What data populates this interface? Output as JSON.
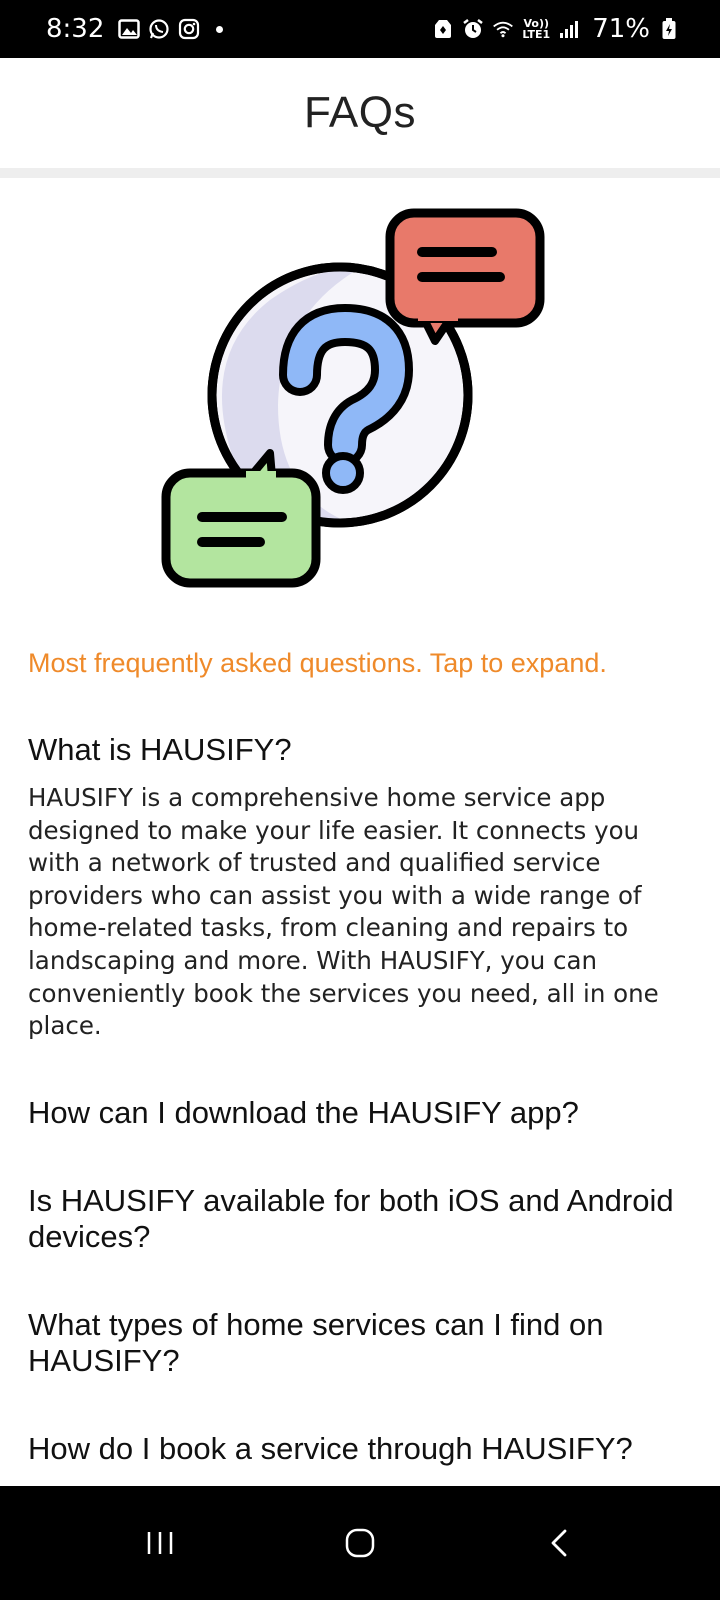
{
  "status_bar": {
    "time": "8:32",
    "network_line1": "Vo))",
    "network_line2": "LTE1",
    "battery": "71%"
  },
  "header": {
    "title": "FAQs"
  },
  "intro": {
    "text": "Most frequently asked questions. Tap to expand."
  },
  "faqs": [
    {
      "question": "What is HAUSIFY?",
      "answer": "HAUSIFY is a comprehensive home service app designed to make your life easier. It connects you with a network of trusted and qualified service providers who can assist you with a wide range of home-related tasks, from cleaning and repairs to landscaping and more. With HAUSIFY, you can conveniently book the services you need, all in one place.",
      "expanded": true
    },
    {
      "question": "How can I download the HAUSIFY app?",
      "expanded": false
    },
    {
      "question": "Is HAUSIFY available for both iOS and Android devices?",
      "expanded": false
    },
    {
      "question": "What types of home services can I find on HAUSIFY?",
      "expanded": false
    },
    {
      "question": "How do I book a service through HAUSIFY?",
      "expanded": false
    }
  ],
  "colors": {
    "accent": "#ef8a2a",
    "bubble_red": "#e8796a",
    "bubble_green": "#b3e59f",
    "question_blue": "#8fb8f7"
  }
}
